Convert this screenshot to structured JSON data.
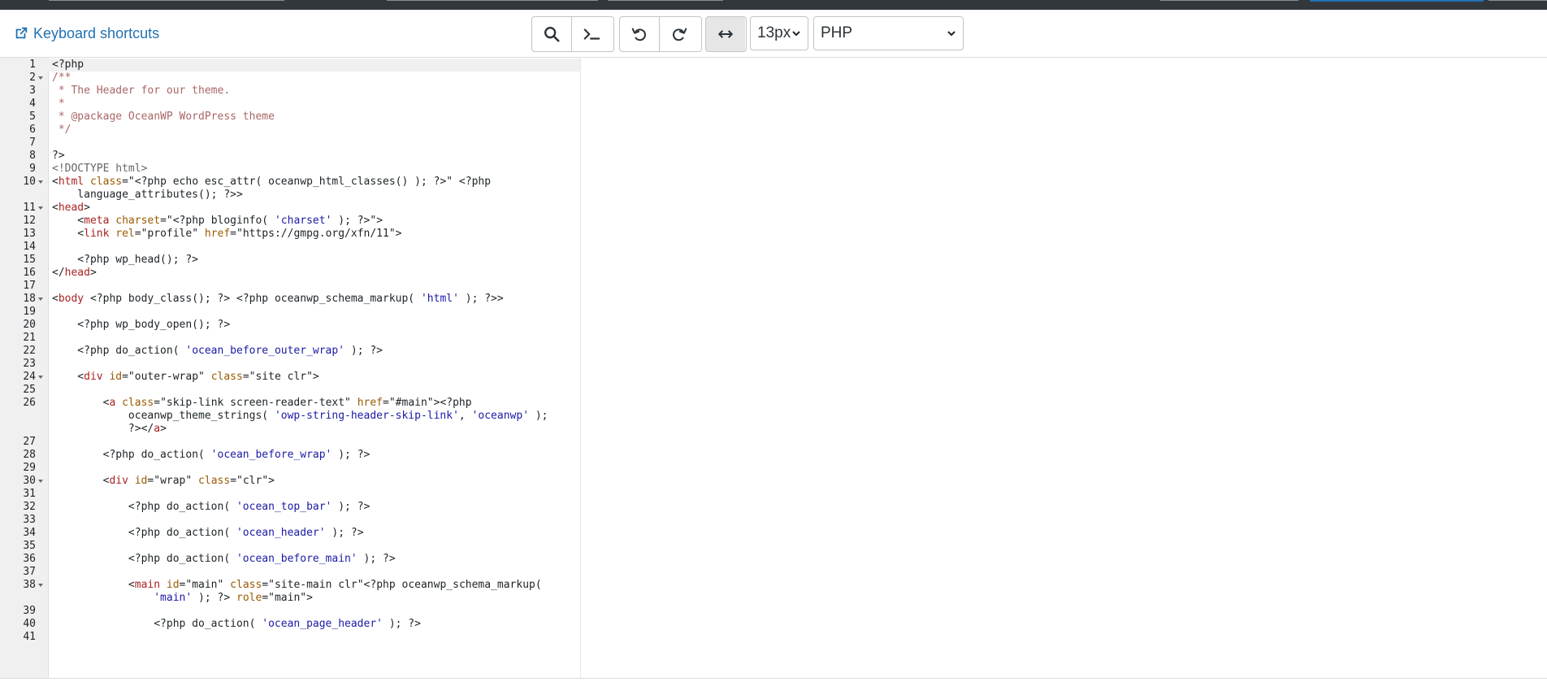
{
  "toolbar": {
    "shortcuts_label": "Keyboard shortcuts",
    "font_size": "13px",
    "language": "PHP"
  },
  "editor": {
    "lines": [
      {
        "n": "1",
        "t": "<?php"
      },
      {
        "n": "2",
        "t": "/**",
        "fold": true
      },
      {
        "n": "3",
        "t": " * The Header for our theme."
      },
      {
        "n": "4",
        "t": " *"
      },
      {
        "n": "5",
        "t": " * @package OceanWP WordPress theme"
      },
      {
        "n": "6",
        "t": " */"
      },
      {
        "n": "7",
        "t": ""
      },
      {
        "n": "8",
        "t": "?>"
      },
      {
        "n": "9",
        "t": "<!DOCTYPE html>"
      },
      {
        "n": "10",
        "t": "<html class=\"<?php echo esc_attr( oceanwp_html_classes() ); ?>\" <?php",
        "fold": true
      },
      {
        "n": "",
        "t": "    language_attributes(); ?>>"
      },
      {
        "n": "11",
        "t": "<head>",
        "fold": true
      },
      {
        "n": "12",
        "t": "    <meta charset=\"<?php bloginfo( 'charset' ); ?>\">"
      },
      {
        "n": "13",
        "t": "    <link rel=\"profile\" href=\"https://gmpg.org/xfn/11\">"
      },
      {
        "n": "14",
        "t": ""
      },
      {
        "n": "15",
        "t": "    <?php wp_head(); ?>"
      },
      {
        "n": "16",
        "t": "</head>"
      },
      {
        "n": "17",
        "t": ""
      },
      {
        "n": "18",
        "t": "<body <?php body_class(); ?> <?php oceanwp_schema_markup( 'html' ); ?>>",
        "fold": true
      },
      {
        "n": "19",
        "t": ""
      },
      {
        "n": "20",
        "t": "    <?php wp_body_open(); ?>"
      },
      {
        "n": "21",
        "t": ""
      },
      {
        "n": "22",
        "t": "    <?php do_action( 'ocean_before_outer_wrap' ); ?>"
      },
      {
        "n": "23",
        "t": ""
      },
      {
        "n": "24",
        "t": "    <div id=\"outer-wrap\" class=\"site clr\">",
        "fold": true
      },
      {
        "n": "25",
        "t": ""
      },
      {
        "n": "26",
        "t": "        <a class=\"skip-link screen-reader-text\" href=\"#main\"><?php"
      },
      {
        "n": "",
        "t": "            oceanwp_theme_strings( 'owp-string-header-skip-link', 'oceanwp' );"
      },
      {
        "n": "",
        "t": "            ?></a>"
      },
      {
        "n": "27",
        "t": ""
      },
      {
        "n": "28",
        "t": "        <?php do_action( 'ocean_before_wrap' ); ?>"
      },
      {
        "n": "29",
        "t": ""
      },
      {
        "n": "30",
        "t": "        <div id=\"wrap\" class=\"clr\">",
        "fold": true
      },
      {
        "n": "31",
        "t": ""
      },
      {
        "n": "32",
        "t": "            <?php do_action( 'ocean_top_bar' ); ?>"
      },
      {
        "n": "33",
        "t": ""
      },
      {
        "n": "34",
        "t": "            <?php do_action( 'ocean_header' ); ?>"
      },
      {
        "n": "35",
        "t": ""
      },
      {
        "n": "36",
        "t": "            <?php do_action( 'ocean_before_main' ); ?>"
      },
      {
        "n": "37",
        "t": ""
      },
      {
        "n": "38",
        "t": "            <main id=\"main\" class=\"site-main clr\"<?php oceanwp_schema_markup(",
        "fold": true
      },
      {
        "n": "",
        "t": "                'main' ); ?> role=\"main\">"
      },
      {
        "n": "39",
        "t": ""
      },
      {
        "n": "40",
        "t": "                <?php do_action( 'ocean_page_header' ); ?>"
      },
      {
        "n": "41",
        "t": ""
      }
    ]
  }
}
